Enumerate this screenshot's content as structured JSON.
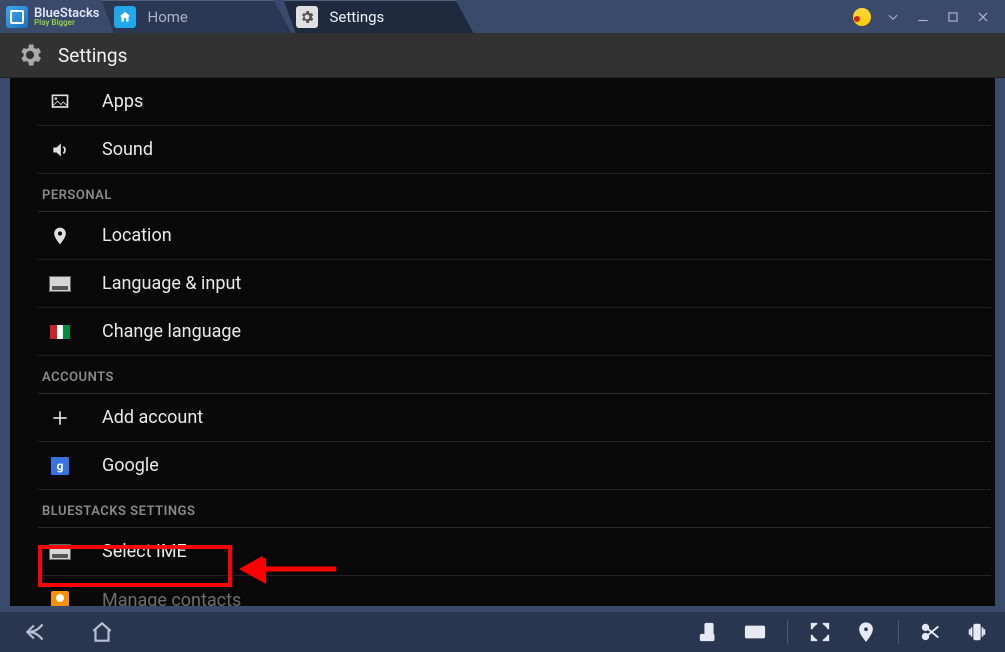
{
  "app": {
    "logo_name": "BlueStacks",
    "logo_tagline": "Play Bigger"
  },
  "tabs": {
    "home": "Home",
    "settings": "Settings"
  },
  "header": {
    "title": "Settings"
  },
  "sections": {
    "device": {
      "items": {
        "apps": "Apps",
        "sound": "Sound"
      }
    },
    "personal": {
      "title": "PERSONAL",
      "items": {
        "location": "Location",
        "language_input": "Language & input",
        "change_language": "Change language"
      }
    },
    "accounts": {
      "title": "ACCOUNTS",
      "items": {
        "add_account": "Add account",
        "google": "Google"
      }
    },
    "bluestacks": {
      "title": "BLUESTACKS SETTINGS",
      "items": {
        "select_ime": "Select IME",
        "manage_contacts": "Manage contacts"
      }
    }
  }
}
